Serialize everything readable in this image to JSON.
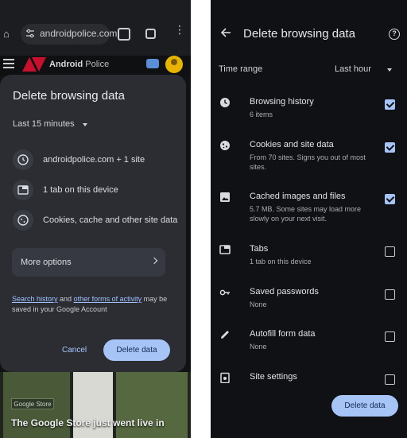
{
  "left": {
    "browser": {
      "url": "androidpolice.com"
    },
    "site": {
      "logo_name": "Android",
      "logo_suffix": "Police"
    },
    "dialog": {
      "title": "Delete browsing data",
      "time_range": "Last 15 minutes",
      "rows": [
        {
          "icon": "history-icon",
          "text": "androidpolice.com + 1 site"
        },
        {
          "icon": "tab-icon",
          "text": "1 tab on this device"
        },
        {
          "icon": "cookie-icon",
          "text": "Cookies, cache and other site data"
        }
      ],
      "more_options": "More options",
      "note_link1": "Search history",
      "note_mid": " and ",
      "note_link2": "other forms of activity",
      "note_tail": " may be saved in your Google Account",
      "cancel": "Cancel",
      "delete": "Delete data"
    },
    "article": {
      "tag": "Google Store",
      "caption": "The Google Store just went live in"
    }
  },
  "right": {
    "title": "Delete browsing data",
    "time_range_label": "Time range",
    "time_range_value": "Last hour",
    "items": [
      {
        "icon": "clock-icon",
        "name": "Browsing history",
        "sub": "6 items",
        "checked": true
      },
      {
        "icon": "cookie-icon",
        "name": "Cookies and site data",
        "sub": "From 70 sites. Signs you out of most sites.",
        "checked": true
      },
      {
        "icon": "image-icon",
        "name": "Cached images and files",
        "sub": "5.7 MB. Some sites may load more slowly on your next visit.",
        "checked": true
      },
      {
        "icon": "tab-icon",
        "name": "Tabs",
        "sub": "1 tab on this device",
        "checked": false
      },
      {
        "icon": "key-icon",
        "name": "Saved passwords",
        "sub": "None",
        "checked": false
      },
      {
        "icon": "pencil-icon",
        "name": "Autofill form data",
        "sub": "None",
        "checked": false
      },
      {
        "icon": "site-settings-icon",
        "name": "Site settings",
        "sub": "",
        "checked": false
      }
    ],
    "delete": "Delete data"
  }
}
